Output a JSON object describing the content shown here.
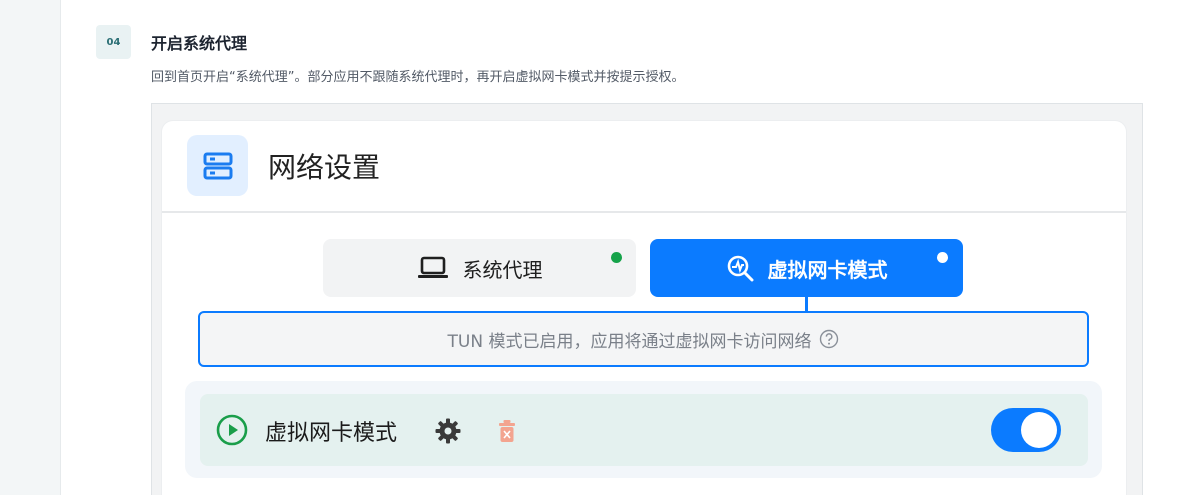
{
  "step": {
    "number": "04",
    "title": "开启系统代理",
    "description": "回到首页开启“系统代理”。部分应用不跟随系统代理时，再开启虚拟网卡模式并按提示授权。"
  },
  "network_settings": {
    "title": "网络设置",
    "header_icon": "server-icon",
    "tabs": [
      {
        "label": "系统代理",
        "icon": "laptop-icon",
        "status": "green"
      },
      {
        "label": "虚拟网卡模式",
        "icon": "tun-search-icon",
        "status": "white",
        "selected": true
      }
    ],
    "info_text": "TUN 模式已启用，应用将通过虚拟网卡访问网络",
    "mode_row": {
      "label": "虚拟网卡模式",
      "enabled": true
    }
  },
  "colors": {
    "accent": "#0b7bff",
    "status_green": "#16a34a",
    "play_green": "#1a9e4a",
    "trash": "#f3a48f"
  }
}
